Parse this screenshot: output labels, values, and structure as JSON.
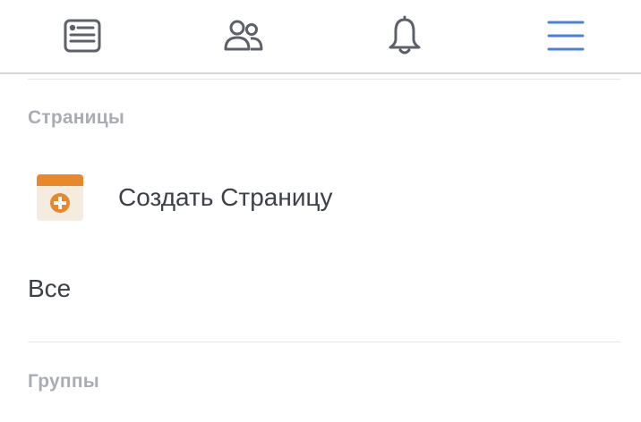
{
  "nav": {
    "tabs": [
      {
        "icon": "news-feed-icon",
        "active": false
      },
      {
        "icon": "friends-icon",
        "active": false
      },
      {
        "icon": "notifications-bell-icon",
        "active": false
      },
      {
        "icon": "menu-hamburger-icon",
        "active": true
      }
    ],
    "colors": {
      "inactive": "#5c6068",
      "active": "#4a7fe0"
    }
  },
  "pages_section": {
    "header": "Страницы",
    "create_page_label": "Создать Страницу",
    "create_page_icon": "create-page-icon",
    "all_label": "Все"
  },
  "groups_section": {
    "header": "Группы"
  },
  "colors": {
    "header_text": "#a9adb3",
    "item_text": "#3c4047",
    "icon_orange": "#e8872c"
  }
}
